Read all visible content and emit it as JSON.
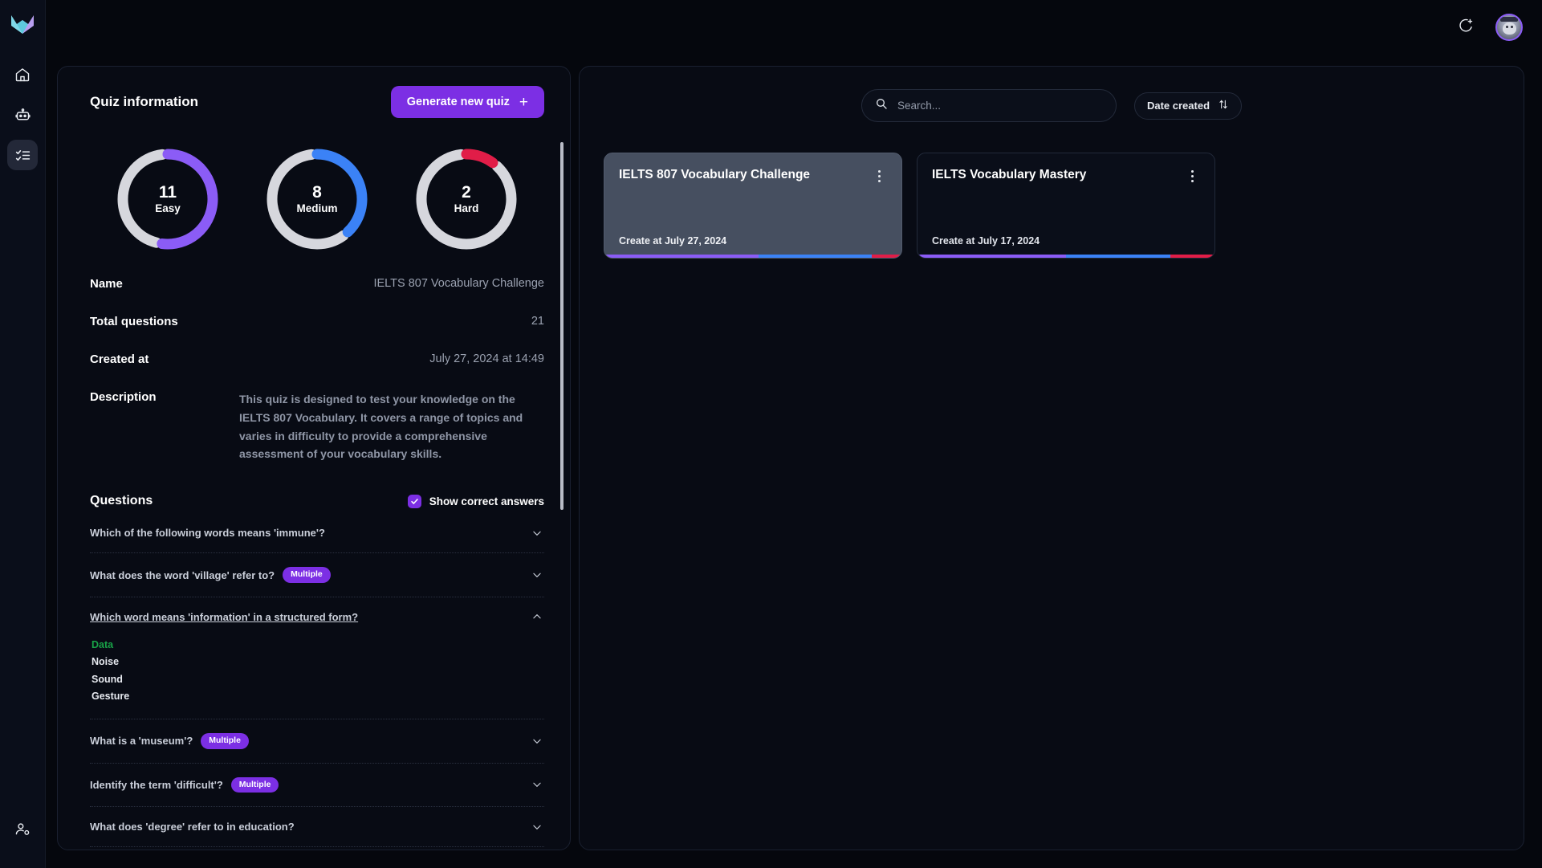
{
  "app": {
    "logo_icon": "origami-fox-logo",
    "background": "#05070d"
  },
  "sidebar": {
    "items": [
      {
        "name": "home",
        "icon": "home-icon",
        "active": false
      },
      {
        "name": "bot",
        "icon": "robot-icon",
        "active": false
      },
      {
        "name": "quiz-list",
        "icon": "checklist-icon",
        "active": true
      }
    ],
    "bottom": {
      "name": "account",
      "icon": "user-settings-icon"
    }
  },
  "topbar": {
    "theme_toggle_icon": "moon-plus-icon",
    "avatar_icon": "user-avatar"
  },
  "left_panel": {
    "title": "Quiz information",
    "generate_button": {
      "label": "Generate new quiz",
      "icon": "plus-icon",
      "color": "#7c2fe4"
    },
    "stats": [
      {
        "value": "11",
        "label": "Easy",
        "percent": 52,
        "color": "#8b5cf6",
        "track": "#d6d7dd"
      },
      {
        "value": "8",
        "label": "Medium",
        "percent": 38,
        "color": "#3b82f6",
        "track": "#d6d7dd"
      },
      {
        "value": "2",
        "label": "Hard",
        "percent": 10,
        "color": "#e11d48",
        "track": "#d6d7dd"
      }
    ],
    "info": [
      {
        "label": "Name",
        "value": "IELTS 807 Vocabulary Challenge"
      },
      {
        "label": "Total questions",
        "value": "21"
      },
      {
        "label": "Created at",
        "value": "July 27, 2024 at 14:49"
      }
    ],
    "description": {
      "label": "Description",
      "value": "This quiz is designed to test your knowledge on the IELTS 807 Vocabulary. It covers a range of topics and varies in difficulty to provide a comprehensive assessment of your vocabulary skills."
    },
    "questions_header": {
      "title": "Questions",
      "show_correct_label": "Show correct answers",
      "show_correct_checked": true,
      "checkbox_color": "#7c2fe4"
    },
    "questions": [
      {
        "text": "Which of the following words means 'immune'?",
        "badge": null,
        "expanded": false,
        "answers": []
      },
      {
        "text": "What does the word 'village' refer to?",
        "badge": "Multiple",
        "expanded": false,
        "answers": []
      },
      {
        "text": "Which word means 'information' in a structured form?",
        "badge": null,
        "expanded": true,
        "answers": [
          {
            "text": "Data",
            "correct": true
          },
          {
            "text": "Noise",
            "correct": false
          },
          {
            "text": "Sound",
            "correct": false
          },
          {
            "text": "Gesture",
            "correct": false
          }
        ]
      },
      {
        "text": "What is a 'museum'?",
        "badge": "Multiple",
        "expanded": false,
        "answers": []
      },
      {
        "text": "Identify the term 'difficult'?",
        "badge": "Multiple",
        "expanded": false,
        "answers": []
      },
      {
        "text": "What does 'degree' refer to in education?",
        "badge": null,
        "expanded": false,
        "answers": []
      }
    ]
  },
  "right_panel": {
    "search": {
      "placeholder": "Search...",
      "value": "",
      "icon": "search-icon"
    },
    "sort": {
      "label": "Date created",
      "icon": "sort-arrows-icon"
    },
    "cards": [
      {
        "title": "IELTS 807 Vocabulary Challenge",
        "date": "Create at July 27, 2024",
        "selected": true,
        "menu_icon": "kebab-menu-icon",
        "bar": [
          {
            "color": "#8b5cf6",
            "percent": 52
          },
          {
            "color": "#3b82f6",
            "percent": 38
          },
          {
            "color": "#e11d48",
            "percent": 10
          }
        ]
      },
      {
        "title": "IELTS Vocabulary Mastery",
        "date": "Create at July 17, 2024",
        "selected": false,
        "menu_icon": "kebab-menu-icon",
        "bar": [
          {
            "color": "#8b5cf6",
            "percent": 50
          },
          {
            "color": "#3b82f6",
            "percent": 35
          },
          {
            "color": "#e11d48",
            "percent": 15
          }
        ]
      }
    ]
  }
}
